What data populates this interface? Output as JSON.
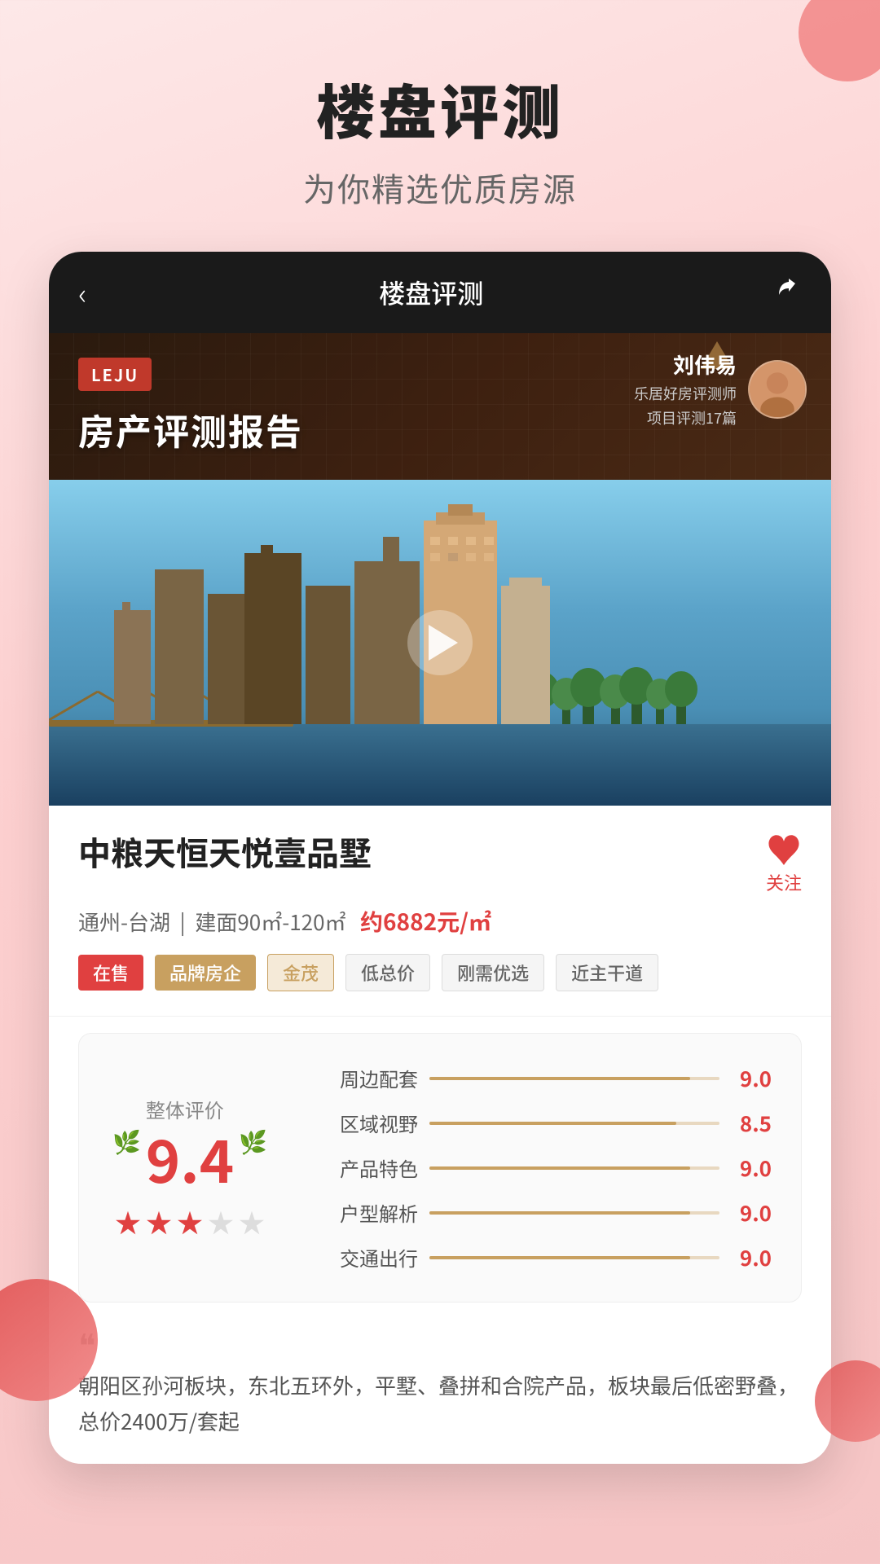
{
  "page": {
    "main_title": "楼盘评测",
    "sub_title": "为你精选优质房源"
  },
  "app_header": {
    "back_label": "‹",
    "title": "楼盘评测",
    "share_label": "⎋"
  },
  "report_banner": {
    "logo": "LEJU",
    "title": "房产评测报告",
    "reviewer_name": "刘伟易",
    "reviewer_desc1": "乐居好房评测师",
    "reviewer_desc2": "项目评测17篇"
  },
  "property": {
    "name": "中粮天恒天悦壹品墅",
    "location": "通州-台湖",
    "area": "建面90㎡-120㎡",
    "price": "约6882元/㎡",
    "favorite_label": "关注",
    "tags": [
      {
        "text": "在售",
        "type": "red"
      },
      {
        "text": "品牌房企",
        "type": "gold"
      },
      {
        "text": "金茂",
        "type": "gold-text"
      },
      {
        "text": "低总价",
        "type": "outline"
      },
      {
        "text": "刚需优选",
        "type": "outline"
      },
      {
        "text": "近主干道",
        "type": "outline"
      }
    ]
  },
  "rating": {
    "overall_label": "整体评价",
    "overall_score": "9.4",
    "stars_filled": 3,
    "stars_empty": 2,
    "items": [
      {
        "label": "周边配套",
        "score": "9.0",
        "percent": 90
      },
      {
        "label": "区域视野",
        "score": "8.5",
        "percent": 85
      },
      {
        "label": "产品特色",
        "score": "9.0",
        "percent": 90
      },
      {
        "label": "户型解析",
        "score": "9.0",
        "percent": 90
      },
      {
        "label": "交通出行",
        "score": "9.0",
        "percent": 90
      }
    ]
  },
  "quote": {
    "mark": "❝",
    "text": "朝阳区孙河板块，东北五环外，平墅、叠拼和合院产品，板块最后低密野叠，总价2400万/套起"
  }
}
